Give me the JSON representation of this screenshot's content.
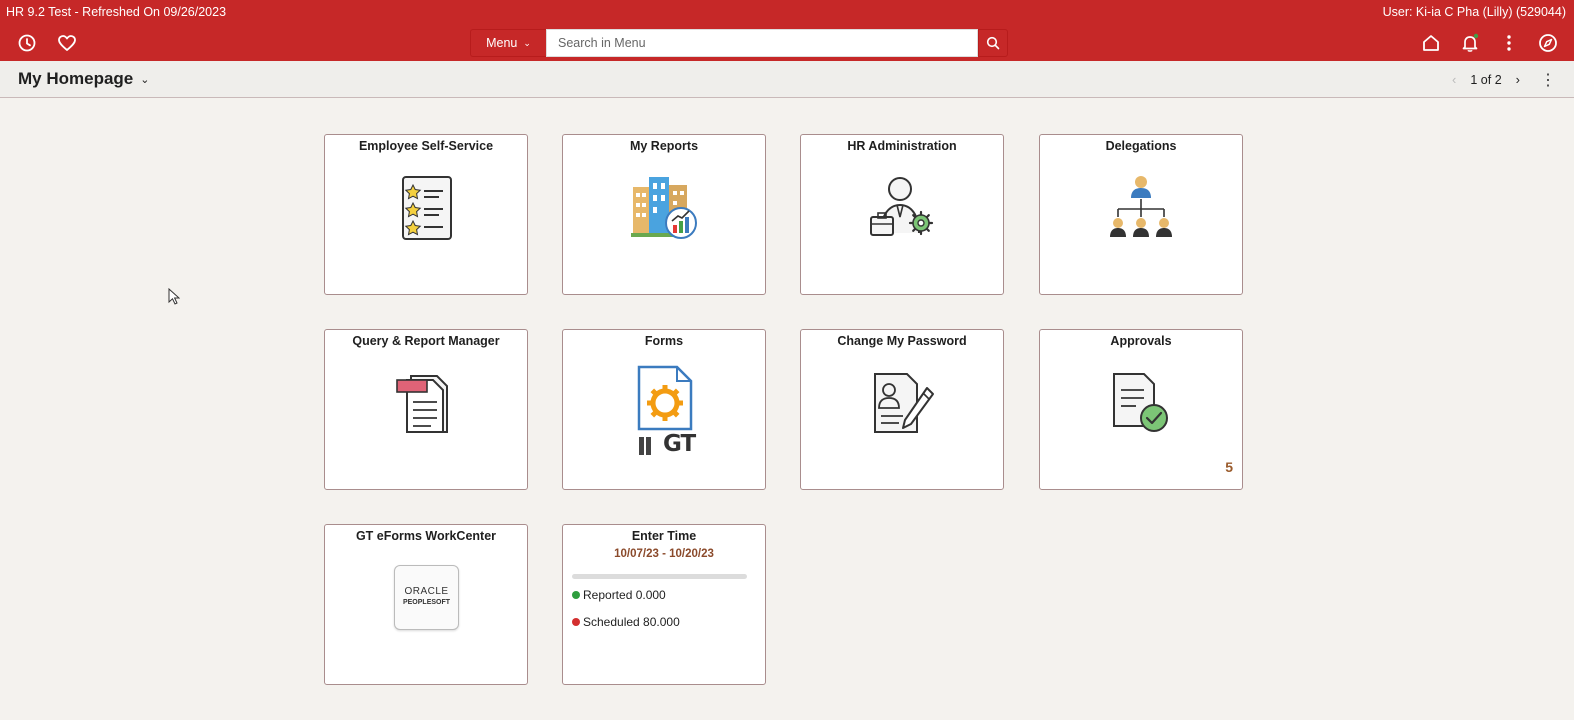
{
  "window": {
    "env_title": "HR 9.2 Test - Refreshed On 09/26/2023",
    "user": "User: Ki-ia C Pha (Lilly) (529044)"
  },
  "header": {
    "menu_label": "Menu",
    "search_placeholder": "Search in Menu",
    "icons": [
      "recent-history-icon",
      "favorites-heart-icon",
      "search-icon",
      "home-icon",
      "notifications-bell-icon",
      "actions-kebab-icon",
      "navigator-compass-icon"
    ],
    "brand_color": "#c62828"
  },
  "subheader": {
    "page_title": "My Homepage",
    "pager": "1 of 2"
  },
  "tiles": [
    {
      "title": "Employee Self-Service",
      "icon": "checklist-stars-icon"
    },
    {
      "title": "My Reports",
      "icon": "buildings-chart-icon"
    },
    {
      "title": "HR Administration",
      "icon": "admin-person-gear-icon"
    },
    {
      "title": "Delegations",
      "icon": "org-hierarchy-icon"
    },
    {
      "title": "Query & Report Manager",
      "icon": "report-documents-icon"
    },
    {
      "title": "Forms",
      "icon": "form-gear-gt-icon",
      "logo_text": "GT"
    },
    {
      "title": "Change My Password",
      "icon": "profile-document-pen-icon"
    },
    {
      "title": "Approvals",
      "icon": "document-check-icon",
      "badge": "5"
    },
    {
      "title": "GT eForms WorkCenter",
      "icon": "oracle-peoplesoft-logo-icon",
      "logo_line1": "ORACLE",
      "logo_line2": "PEOPLESOFT"
    },
    {
      "title": "Enter Time",
      "dates": "10/07/23 - 10/20/23",
      "reported": "Reported 0.000",
      "scheduled": "Scheduled 80.000",
      "progress": 0
    }
  ]
}
